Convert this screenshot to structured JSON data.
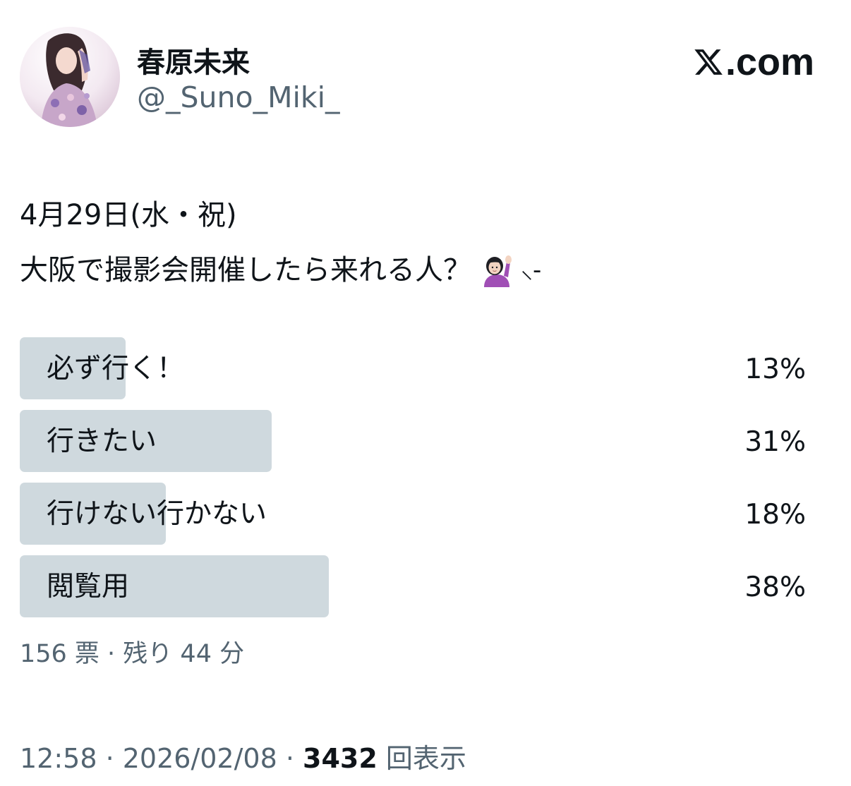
{
  "author": {
    "display_name": "春原未来",
    "handle": "@_Suno_Miki_"
  },
  "brand": {
    "logo_icon": "x-logo-icon",
    "domain": ".com"
  },
  "tweet": {
    "line1": "4月29日(水・祝)",
    "line2": "大阪で撮影会開催したら来れる人？",
    "emoji": "person-raising-hand-icon",
    "doodle": "⸜-"
  },
  "poll": {
    "options": [
      {
        "label": "必ず行く！",
        "percent": "13%",
        "fraction": 0.13
      },
      {
        "label": "行きたい",
        "percent": "31%",
        "fraction": 0.31
      },
      {
        "label": "行けない行かない",
        "percent": "18%",
        "fraction": 0.18
      },
      {
        "label": "閲覧用",
        "percent": "38%",
        "fraction": 0.38
      }
    ],
    "meta": "156 票 · 残り 44 分"
  },
  "footer": {
    "time_date": "12:58 · 2026/02/08 · ",
    "views_count": "3432",
    "views_label": " 回表示"
  },
  "colors": {
    "text": "#0f1419",
    "secondary": "#536471",
    "poll_bar": "#cfd9de",
    "background": "#ffffff"
  }
}
